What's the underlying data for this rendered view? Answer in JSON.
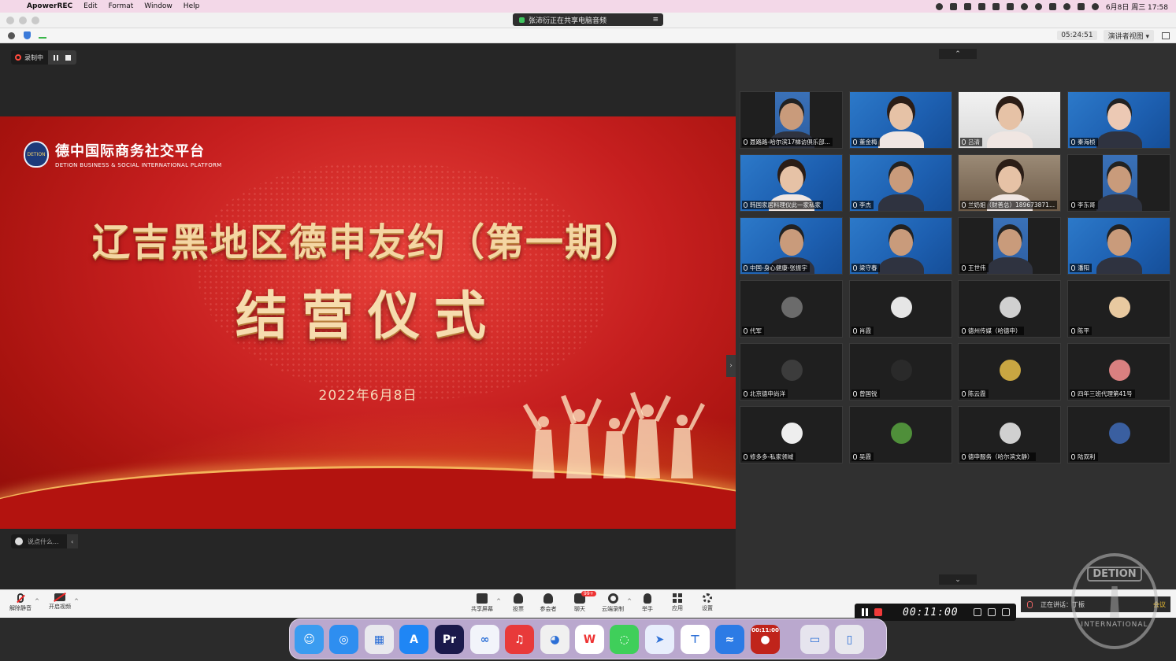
{
  "menubar": {
    "app_name": "ApowerREC",
    "items": [
      "Edit",
      "Format",
      "Window",
      "Help"
    ],
    "date_time": "6月8日 周三  17:58"
  },
  "titlebar": {
    "share_banner": "张沛衍正在共享电脑音频",
    "share_menu": "≡"
  },
  "zoombar": {
    "meeting_timer": "05:24:51",
    "view_mode": "演讲者视图 ▾"
  },
  "recording": {
    "label": "录制中"
  },
  "slide": {
    "logo_badge": "DETION",
    "logo_cn": "德中国际商务社交平台",
    "logo_en": "DETION BUSINESS & SOCIAL INTERNATIONAL PLATFORM",
    "title": "辽吉黑地区德申友约（第一期）",
    "subtitle": "结营仪式",
    "date": "2022年6月8日"
  },
  "chat": {
    "placeholder": "说点什么..."
  },
  "gallery": {
    "tiles": [
      {
        "label": "聂路路-哈尔滨17梯访俱乐部...",
        "style": "dark",
        "person": "man"
      },
      {
        "label": "董金梅",
        "style": "video",
        "person": "woman"
      },
      {
        "label": "吕清",
        "style": "light",
        "person": "woman"
      },
      {
        "label": "秦海桢",
        "style": "video",
        "person": "elder"
      },
      {
        "label": "韩国家居料理仪此一家私家",
        "style": "video",
        "person": "woman"
      },
      {
        "label": "李杰",
        "style": "video",
        "person": "man"
      },
      {
        "label": "兰奶姐（财善总）189673871...",
        "style": "room",
        "person": "woman"
      },
      {
        "label": "李东哥",
        "style": "dark",
        "person": "man"
      },
      {
        "label": "中国-身心健康-张振宇",
        "style": "video",
        "person": "man"
      },
      {
        "label": "梁守春",
        "style": "video",
        "person": "man"
      },
      {
        "label": "王世伟",
        "style": "dark",
        "person": "man"
      },
      {
        "label": "潘阳",
        "style": "video",
        "person": "man"
      },
      {
        "label": "代军",
        "style": "avatar",
        "color": "#6b6b6b"
      },
      {
        "label": "肖霞",
        "style": "avatar",
        "color": "#e6e6e6"
      },
      {
        "label": "德州传媒（哈德申）",
        "style": "avatar",
        "color": "#d0d0d0"
      },
      {
        "label": "陈平",
        "style": "avatar",
        "color": "#e8c9a0"
      },
      {
        "label": "北京德申尚洋",
        "style": "avatar",
        "color": "#3c3c3c"
      },
      {
        "label": "曾国锐",
        "style": "avatar",
        "color": "#2a2a2a"
      },
      {
        "label": "陈云霞",
        "style": "avatar",
        "color": "#c9a642"
      },
      {
        "label": "四年三班代理第41号",
        "style": "avatar",
        "color": "#d98080"
      },
      {
        "label": "修多多-私家领域",
        "style": "avatar",
        "color": "#eeeeee"
      },
      {
        "label": "吴霞",
        "style": "avatar",
        "color": "#4f8f3a"
      },
      {
        "label": "德申服务（哈尔滨文静）",
        "style": "avatar",
        "color": "#d0d0d0"
      },
      {
        "label": "陆双利",
        "style": "avatar",
        "color": "#3a5fa0"
      }
    ]
  },
  "controls": {
    "unmute": "解除静音",
    "start_video": "开启视频",
    "share": "共享屏幕",
    "polls": "投票",
    "participants": "参会者",
    "chat": "聊天",
    "chat_badge": "99+",
    "record": "云端录制",
    "reactions": "举手",
    "apps": "应用",
    "settings": "设置",
    "speaking": "正在讲话：丁振",
    "speaking_tail": "会议"
  },
  "recorder": {
    "time": "00:11:00"
  },
  "dock": {
    "apps": [
      {
        "name": "finder-app",
        "color": "#3b9cf0",
        "glyph": "☺"
      },
      {
        "name": "safari-app",
        "color": "#2e8ef0",
        "glyph": "◎"
      },
      {
        "name": "launchpad-app",
        "color": "#e9e9ee",
        "glyph": "▦"
      },
      {
        "name": "app-store-app",
        "color": "#1f86f5",
        "glyph": "A"
      },
      {
        "name": "premiere-app",
        "color": "#1b1a4b",
        "glyph": "Pr"
      },
      {
        "name": "baidu-netdisk-app",
        "color": "#f2f4fa",
        "glyph": "∞"
      },
      {
        "name": "netease-music-app",
        "color": "#e83a3a",
        "glyph": "♫"
      },
      {
        "name": "qq-app",
        "color": "#f0f0f0",
        "glyph": "◕"
      },
      {
        "name": "wps-app",
        "color": "#ffffff",
        "glyph": "W"
      },
      {
        "name": "wechat-app",
        "color": "#3fcf5a",
        "glyph": "◌"
      },
      {
        "name": "feishu-app",
        "color": "#e8eefc",
        "glyph": "➤"
      },
      {
        "name": "tencent-meeting-app",
        "color": "#ffffff",
        "glyph": "⊤"
      },
      {
        "name": "lark-app",
        "color": "#2c7be5",
        "glyph": "≈"
      },
      {
        "name": "apowerrec-app",
        "color": "#c0241b",
        "glyph": "●",
        "small": "00:11:00"
      },
      {
        "name": "downloads-folder",
        "color": "#e6e4ee",
        "glyph": "▭"
      },
      {
        "name": "trash-app",
        "color": "#e8e8ee",
        "glyph": "▯"
      }
    ]
  },
  "stamp": {
    "top": "DETION",
    "bottom": "INTERNATIONAL"
  }
}
